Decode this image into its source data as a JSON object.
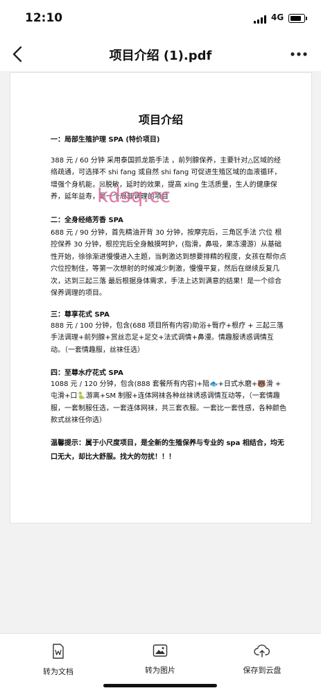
{
  "status_bar": {
    "time": "12:10",
    "network": "4G"
  },
  "nav": {
    "title": "项目介绍 (1).pdf",
    "back_icon": "chevron-left-icon",
    "more_icon": "ellipsis-icon"
  },
  "document": {
    "title": "项目介绍",
    "watermark": "kdsq.cc",
    "paragraphs": [
      "一：局部生殖护理 SPA (特价项目)",
      "388 元 / 60 分钟  采用泰国抓龙筋手法 ，前列腺保养，主要针对△区域的经络疏通，可选择不 shi fang 或自然 shi fang 可促进生殖区域的血液循环，增强个身机能，☒脱敏，延时的效果，提高 xing 生活质量，生人的健康保养，延年益寿，是一个局部调理的项目",
      "二：全身经络芳香 SPA",
      "688 元 / 90 分钟，首先精油开背 30 分钟，按摩完后，三角区手法 穴位 根控保养 30 分钟，根控完后全身触摸呵护，(指滑，鼻吸，果冻漫游）从基础性开始，徐徐渐进慢慢进入主题，当刺激达到想要排精的程度，女孩在帮你点穴位控制住，等第一次想射的时候减少刺激，慢慢平复，然后在继续反复几次，达到三起三落 最后根据身体需求，手法上达到满意的结果！是一个综合保养调理的项目。",
      "三：尊享花式 SPA",
      "888 元 / 100 分钟，包含(688 项目所有内容)助浴+臀疗+根疗 + 三起三落手法调理+前列腺+赏丝恋足+足交+法式调情+鼻漫。情趣服诱惑调情互动。（一套情趣服，丝袜任选）",
      "四：至尊水疗花式 SPA",
      "1088 元 / 120 分钟，包含(888 套餐所有内容)+陪🐟+日式水磨+🐻滑 + 屯滑+口🐍游离+SM 制服+连体网袜各种丝袜诱惑调情互动等，（一套情趣服，一套制服任选，一套连体网袜，共三套衣服。一套比一套性感，各种颜色款式丝袜任你选）",
      "温馨提示：属于小尺度项目，是全新的生殖保养与专业的 spa 相结合，均无口无大，却比大舒服。找大的勿扰！！！"
    ]
  },
  "bottom_actions": [
    {
      "label": "转为文档",
      "icon": "word-doc-icon"
    },
    {
      "label": "转为图片",
      "icon": "image-icon"
    },
    {
      "label": "保存到云盘",
      "icon": "cloud-upload-icon"
    }
  ]
}
